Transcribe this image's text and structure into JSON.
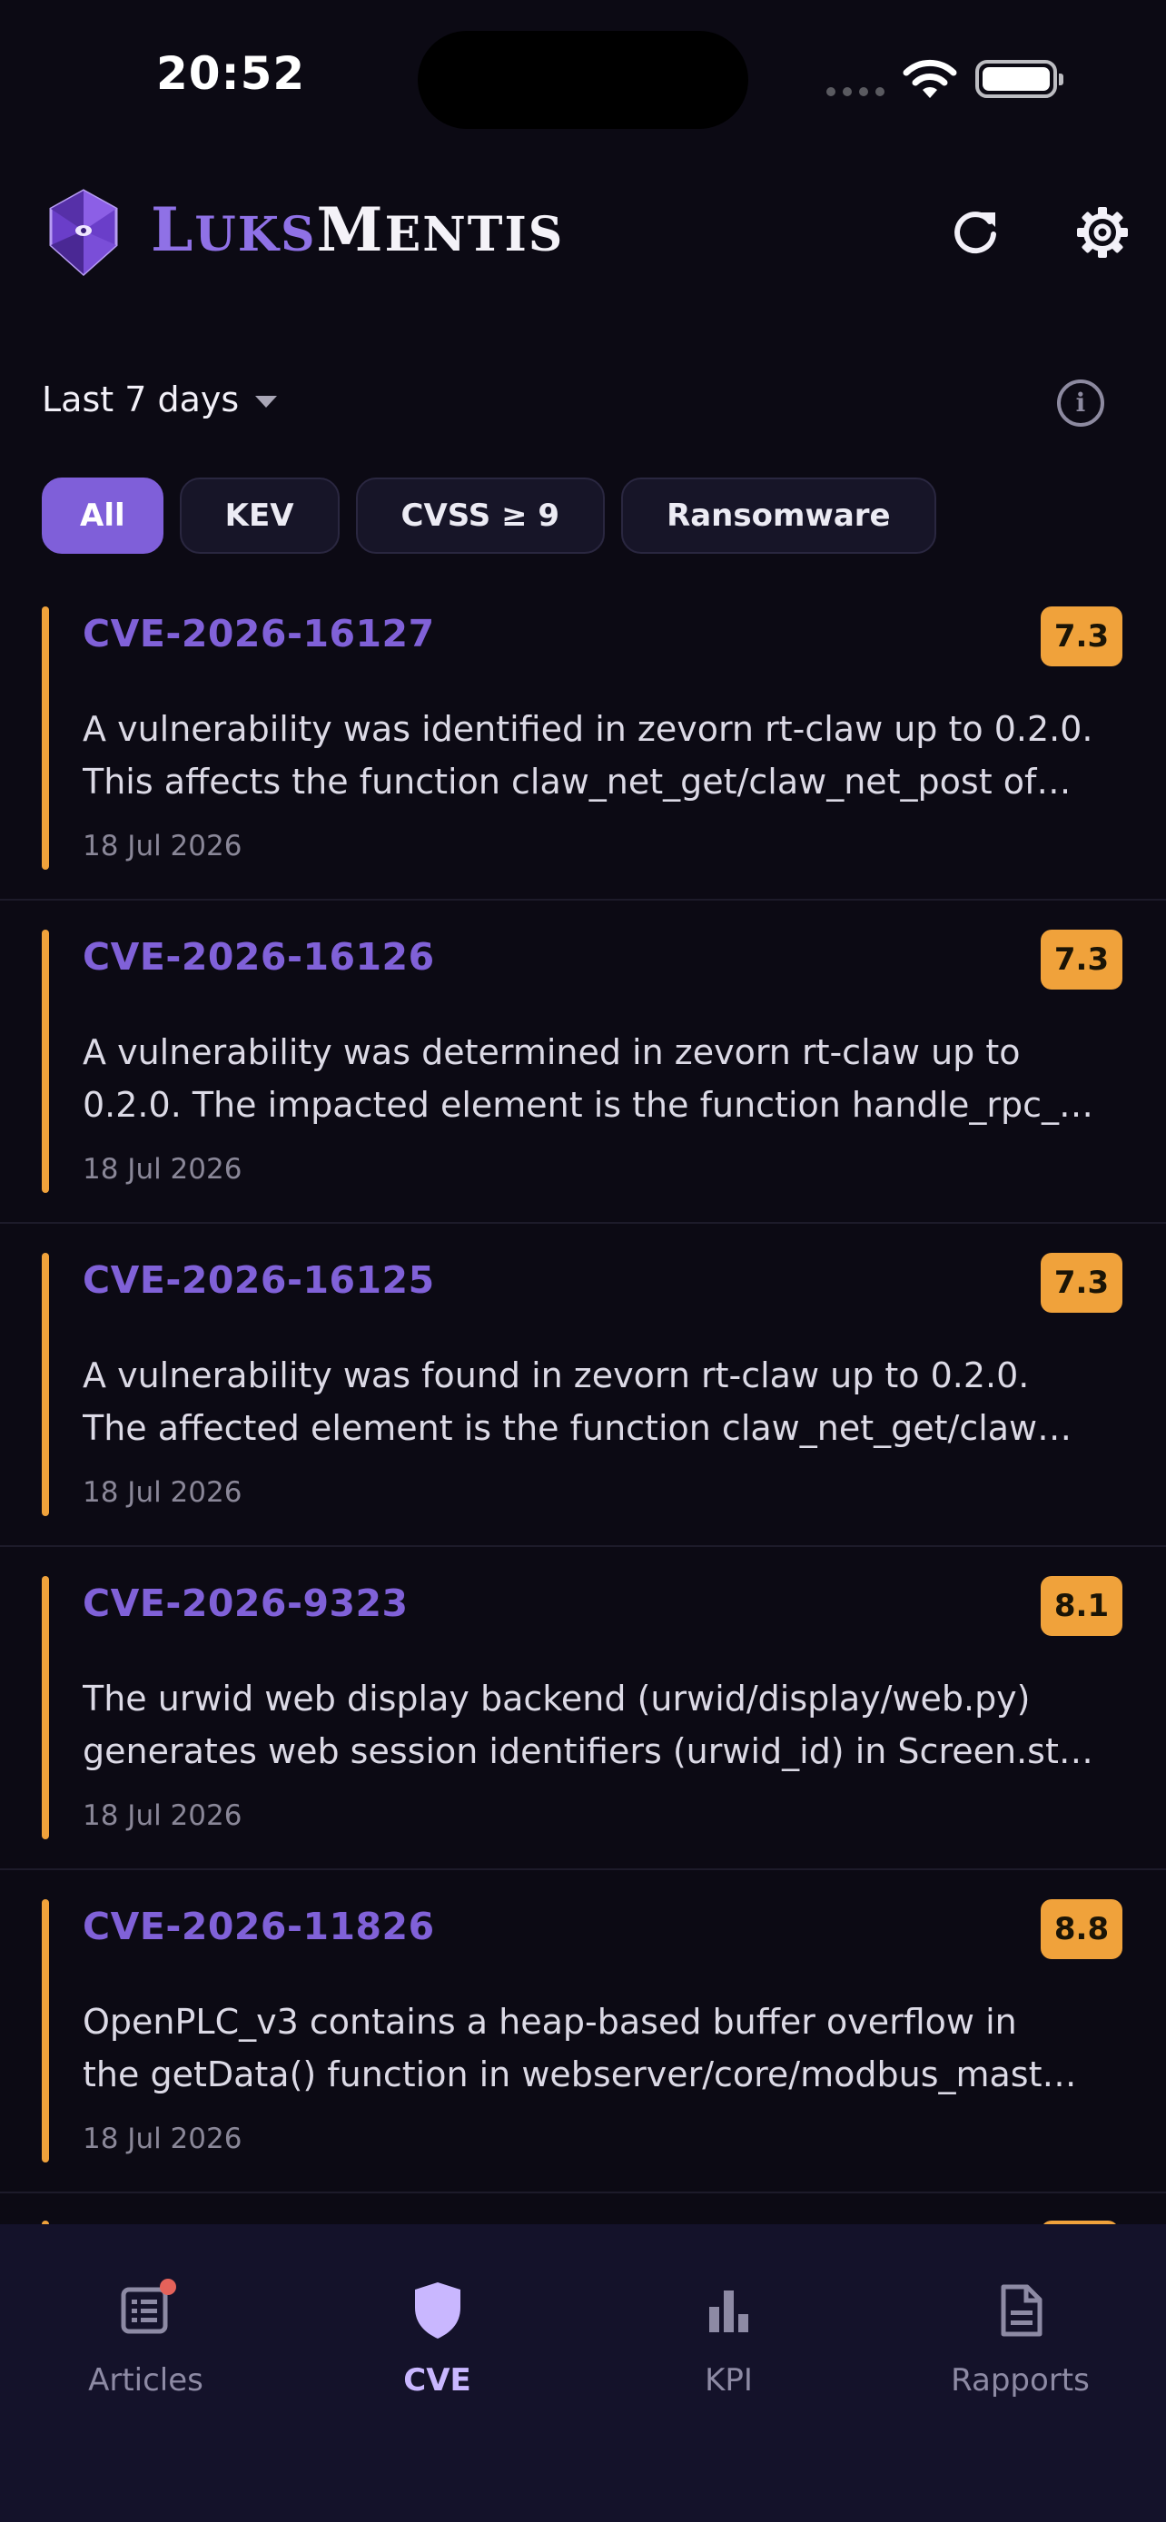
{
  "status_bar": {
    "time": "20:52"
  },
  "header": {
    "brand_part1": "Luks",
    "brand_part2": "Mentis",
    "colors": {
      "accent": "#8f71e6",
      "brand_light": "#f4f2f8"
    }
  },
  "filters": {
    "range_label": "Last 7 days",
    "chips": [
      {
        "label": "All",
        "active": true
      },
      {
        "label": "KEV",
        "active": false
      },
      {
        "label": "CVSS ≥ 9",
        "active": false
      },
      {
        "label": "Ransomware",
        "active": false
      }
    ]
  },
  "cves": [
    {
      "id": "CVE-2026-16127",
      "score": "7.3",
      "desc_line1": "A vulnerability was identified in zevorn rt-claw up to 0.2.0.",
      "desc_line2": "This affects the function claw_net_get/claw_net_post of…",
      "date": "18 Jul 2026"
    },
    {
      "id": "CVE-2026-16126",
      "score": "7.3",
      "desc_line1": "A vulnerability was determined in zevorn rt-claw up to",
      "desc_line2": "0.2.0. The impacted element is the function handle_rpc_…",
      "date": "18 Jul 2026"
    },
    {
      "id": "CVE-2026-16125",
      "score": "7.3",
      "desc_line1": "A vulnerability was found in zevorn rt-claw up to 0.2.0.",
      "desc_line2": "The affected element is the function claw_net_get/claw…",
      "date": "18 Jul 2026"
    },
    {
      "id": "CVE-2026-9323",
      "score": "8.1",
      "desc_line1": "The urwid web display backend (urwid/display/web.py)",
      "desc_line2": "generates web session identifiers (urwid_id) in Screen.st…",
      "date": "18 Jul 2026"
    },
    {
      "id": "CVE-2026-11826",
      "score": "8.8",
      "desc_line1": "OpenPLC_v3 contains a heap-based buffer overflow in",
      "desc_line2": "the getData() function in webserver/core/modbus_mast…",
      "date": "18 Jul 2026"
    }
  ],
  "tabbar": {
    "tabs": [
      {
        "label": "Articles",
        "icon": "news-icon"
      },
      {
        "label": "CVE",
        "icon": "shield-icon"
      },
      {
        "label": "KPI",
        "icon": "bar-chart-icon"
      },
      {
        "label": "Rapports",
        "icon": "document-icon"
      }
    ],
    "active": "CVE"
  },
  "colors": {
    "background": "#0c0a14",
    "severity": "#f0a23b",
    "cve_id": "#8061d8",
    "active_chip": "#7f5fd9",
    "unread_dot": "#e5625a"
  }
}
